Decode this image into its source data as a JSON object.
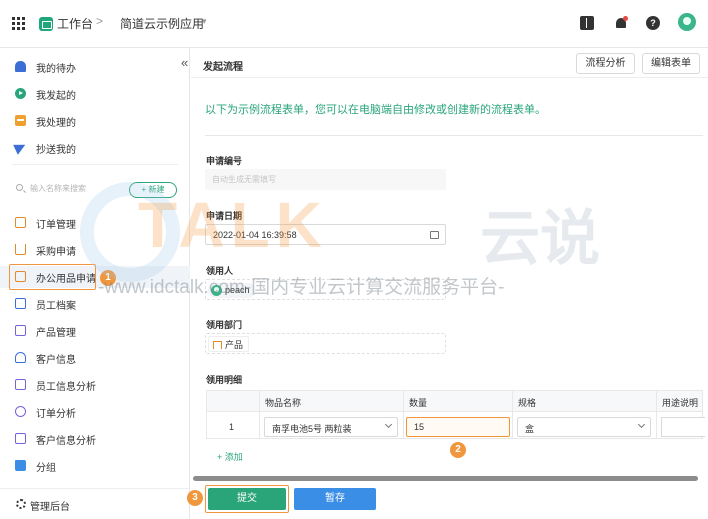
{
  "topbar": {
    "workspace": "工作台",
    "separator": ">",
    "app_name": "简道云示例应用",
    "app_caret": "▾",
    "help_glyph": "?"
  },
  "sidebar": {
    "collapse_glyph": "«",
    "top_items": [
      {
        "label": "我的待办",
        "icon": "bell-icon"
      },
      {
        "label": "我发起的",
        "icon": "play-circle-icon"
      },
      {
        "label": "我处理的",
        "icon": "inbox-icon"
      },
      {
        "label": "抄送我的",
        "icon": "send-icon"
      }
    ],
    "search_placeholder": "输入名称来搜索",
    "new_label": "+ 新建",
    "items": [
      {
        "label": "订单管理",
        "icon": "form-icon"
      },
      {
        "label": "采购申请",
        "icon": "cart-icon"
      },
      {
        "label": "办公用品申请",
        "icon": "form-icon",
        "active": true
      },
      {
        "label": "员工档案",
        "icon": "form-icon"
      },
      {
        "label": "产品管理",
        "icon": "form-icon"
      },
      {
        "label": "客户信息",
        "icon": "person-icon"
      },
      {
        "label": "员工信息分析",
        "icon": "report-icon"
      },
      {
        "label": "订单分析",
        "icon": "pie-icon"
      },
      {
        "label": "客户信息分析",
        "icon": "monitor-icon"
      },
      {
        "label": "分组",
        "icon": "folder-icon"
      }
    ],
    "admin_label": "管理后台"
  },
  "markers": {
    "m1": "1",
    "m2": "2",
    "m3": "3"
  },
  "header": {
    "title": "发起流程",
    "btn_flow_analysis": "流程分析",
    "btn_edit_form": "编辑表单"
  },
  "form": {
    "intro": "以下为示例流程表单，您可以在电脑端自由修改或创建新的流程表单。",
    "serial": {
      "label": "申请编号",
      "placeholder": "自动生成无需填写"
    },
    "date": {
      "label": "申请日期",
      "value": "2022-01-04 16:39:58"
    },
    "recipient": {
      "label": "领用人",
      "value": "peach"
    },
    "department": {
      "label": "领用部门",
      "value": "产品"
    },
    "details": {
      "label": "领用明细",
      "columns": [
        "物品名称",
        "数量",
        "规格",
        "用途说明"
      ],
      "rows": [
        {
          "index": "1",
          "item": "南孚电池5号 两粒装",
          "qty": "15",
          "spec": "盒",
          "purpose": ""
        }
      ],
      "add_label": "+ 添加"
    }
  },
  "footer": {
    "submit": "提交",
    "draft": "暂存"
  },
  "watermark": {
    "text_talk": "TALK",
    "text_cn": "云说",
    "line": "-www.idctalk.com-国内专业云计算交流服务平台-"
  },
  "colors": {
    "accent": "#2aa57a",
    "highlight": "#f0963c",
    "primary_blue": "#3b8ee6"
  }
}
